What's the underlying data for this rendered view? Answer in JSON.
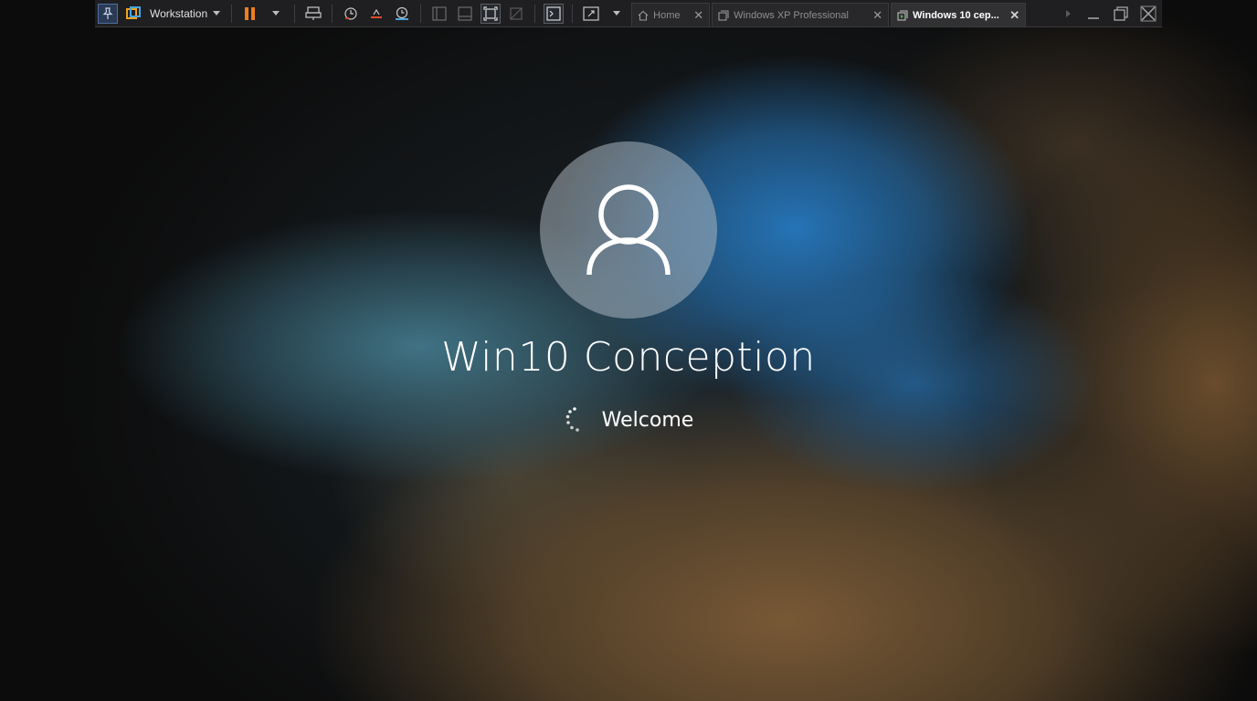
{
  "toolbar": {
    "product_label": "Workstation",
    "tabs": [
      {
        "label": "Home",
        "active": false
      },
      {
        "label": "Windows XP Professional",
        "active": false
      },
      {
        "label": "Windows 10 cep...",
        "active": true
      }
    ]
  },
  "login": {
    "user_name": "Win10 Conception",
    "status": "Welcome"
  },
  "icons": {
    "pin": "pin-icon",
    "workstation": "workstation-logo-icon",
    "pause": "pause-icon",
    "send_ctrl_alt_del": "send-keys-icon",
    "snapshot": "snapshot-icon",
    "revert_snapshot": "revert-snapshot-icon",
    "snapshot_manager": "snapshot-manager-icon",
    "console_view": "console-icon",
    "fullscreen": "fullscreen-icon",
    "home_tab": "home-icon",
    "vm_tab": "vm-icon",
    "user": "user-avatar-icon",
    "spinner": "loading-spinner-icon"
  },
  "colors": {
    "toolbar_bg": "#1f1f21",
    "pause_orange": "#f07d1d",
    "accent_blue": "#4d6fa0",
    "text_white": "#ffffff"
  }
}
